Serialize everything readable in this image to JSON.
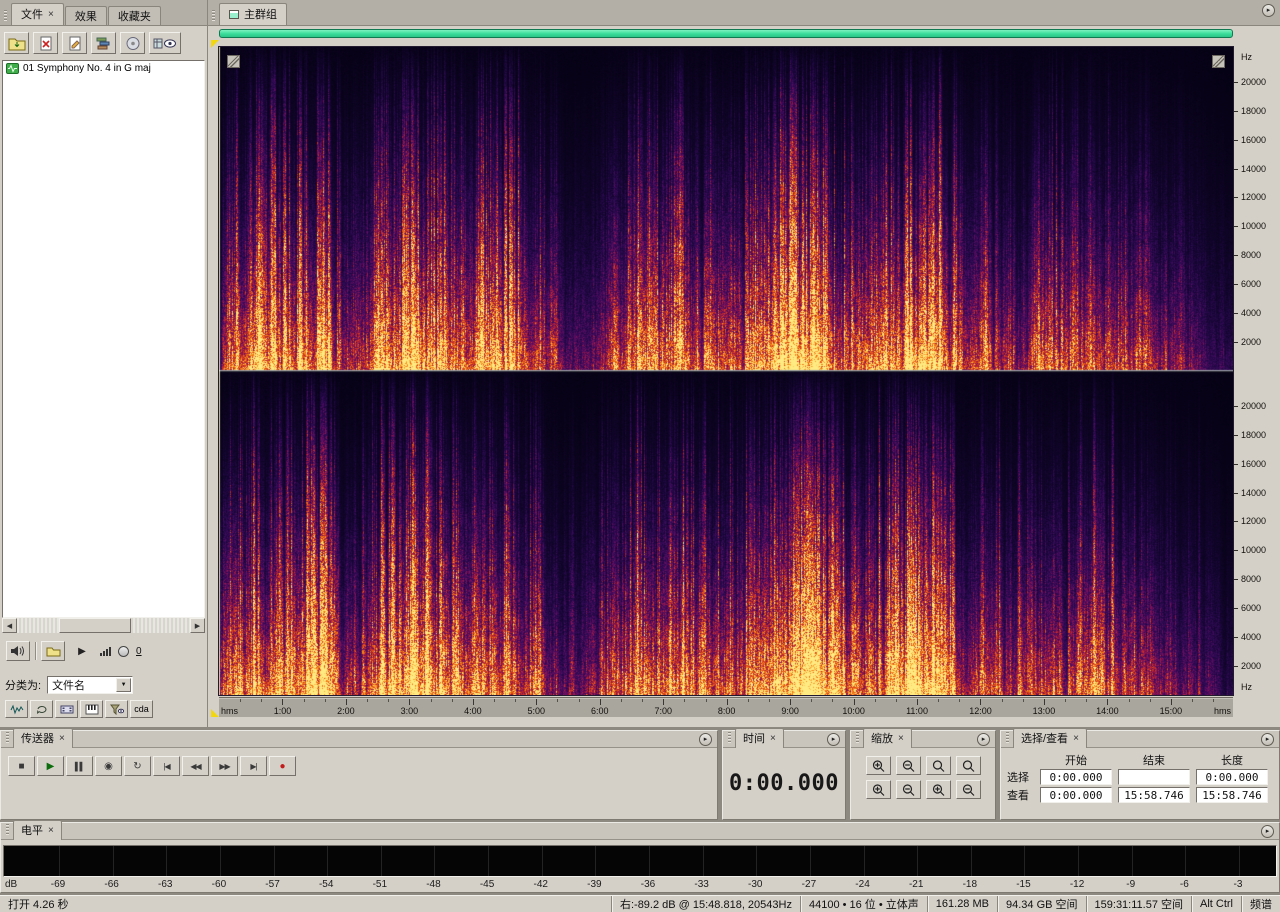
{
  "files_panel": {
    "tabs": [
      {
        "label": "文件",
        "close": "×",
        "active": true
      },
      {
        "label": "效果",
        "close": "",
        "active": false
      },
      {
        "label": "收藏夹",
        "close": "",
        "active": false
      }
    ],
    "toolbar_icons": [
      "import-file",
      "close-file",
      "edit-file",
      "insert-into-multitrack",
      "insert-into-cd"
    ],
    "files": [
      {
        "name": "01 Symphony No. 4 in G maj"
      }
    ],
    "preview_loop_count": "0",
    "sort_label": "分类为:",
    "sort_value": "文件名",
    "filter_icons": [
      "show-audio",
      "show-loop",
      "show-video",
      "show-midi",
      "show-filter"
    ],
    "cd_button_label": "cda"
  },
  "main_group": {
    "tab_label": "主群组",
    "freq_unit": "Hz",
    "freq_ticks": [
      20000,
      18000,
      16000,
      14000,
      12000,
      10000,
      8000,
      6000,
      4000,
      2000
    ],
    "freq_max": 22400,
    "timeline_unit": "hms",
    "timeline_minutes": [
      "1:00",
      "2:00",
      "3:00",
      "4:00",
      "5:00",
      "6:00",
      "7:00",
      "8:00",
      "9:00",
      "10:00",
      "11:00",
      "12:00",
      "13:00",
      "14:00",
      "15:00"
    ],
    "view_duration_seconds": 958.746
  },
  "spectrogram": {
    "channels": 2,
    "background": "#0a0418",
    "palette": [
      "#060214",
      "#160634",
      "#340a58",
      "#691062",
      "#aa1c3c",
      "#de4018",
      "#f88814",
      "#ffeb82"
    ]
  },
  "transport_panel": {
    "title": "传送器",
    "close": "×",
    "buttons": [
      "stop",
      "play",
      "pause",
      "play-from-cursor",
      "loop-play",
      "go-to-start",
      "rewind",
      "fast-forward",
      "go-to-end",
      "record"
    ]
  },
  "time_panel": {
    "title": "时间",
    "close": "×",
    "value": "0:00.000"
  },
  "zoom_panel": {
    "title": "缩放",
    "close": "×",
    "buttons": [
      "zoom-in-horizontal",
      "zoom-out-horizontal",
      "zoom-full",
      "zoom-to-selection",
      "zoom-in",
      "zoom-out",
      "zoom-in-vertical",
      "zoom-out-vertical"
    ]
  },
  "selection_panel": {
    "title": "选择/查看",
    "close": "×",
    "col_headers": [
      "开始",
      "结束",
      "长度"
    ],
    "rows": [
      {
        "label": "选择",
        "start": "0:00.000",
        "end": "",
        "length": "0:00.000"
      },
      {
        "label": "查看",
        "start": "0:00.000",
        "end": "15:58.746",
        "length": "15:58.746"
      }
    ]
  },
  "level_panel": {
    "title": "电平",
    "close": "×",
    "unit": "dB",
    "ticks": [
      -69,
      -66,
      -63,
      -60,
      -57,
      -54,
      -51,
      -48,
      -45,
      -42,
      -39,
      -36,
      -33,
      -30,
      -27,
      -24,
      -21,
      -18,
      -15,
      -12,
      -9,
      -6,
      -3
    ]
  },
  "status_bar": {
    "open_time": "打开 4.26 秒",
    "fields": [
      "右:-89.2 dB @ 15:48.818, 20543Hz",
      "44100 • 16 位 • 立体声",
      "161.28 MB",
      "94.34 GB 空间",
      "159:31:11.57 空间",
      "Alt Ctrl",
      "频谱"
    ]
  }
}
